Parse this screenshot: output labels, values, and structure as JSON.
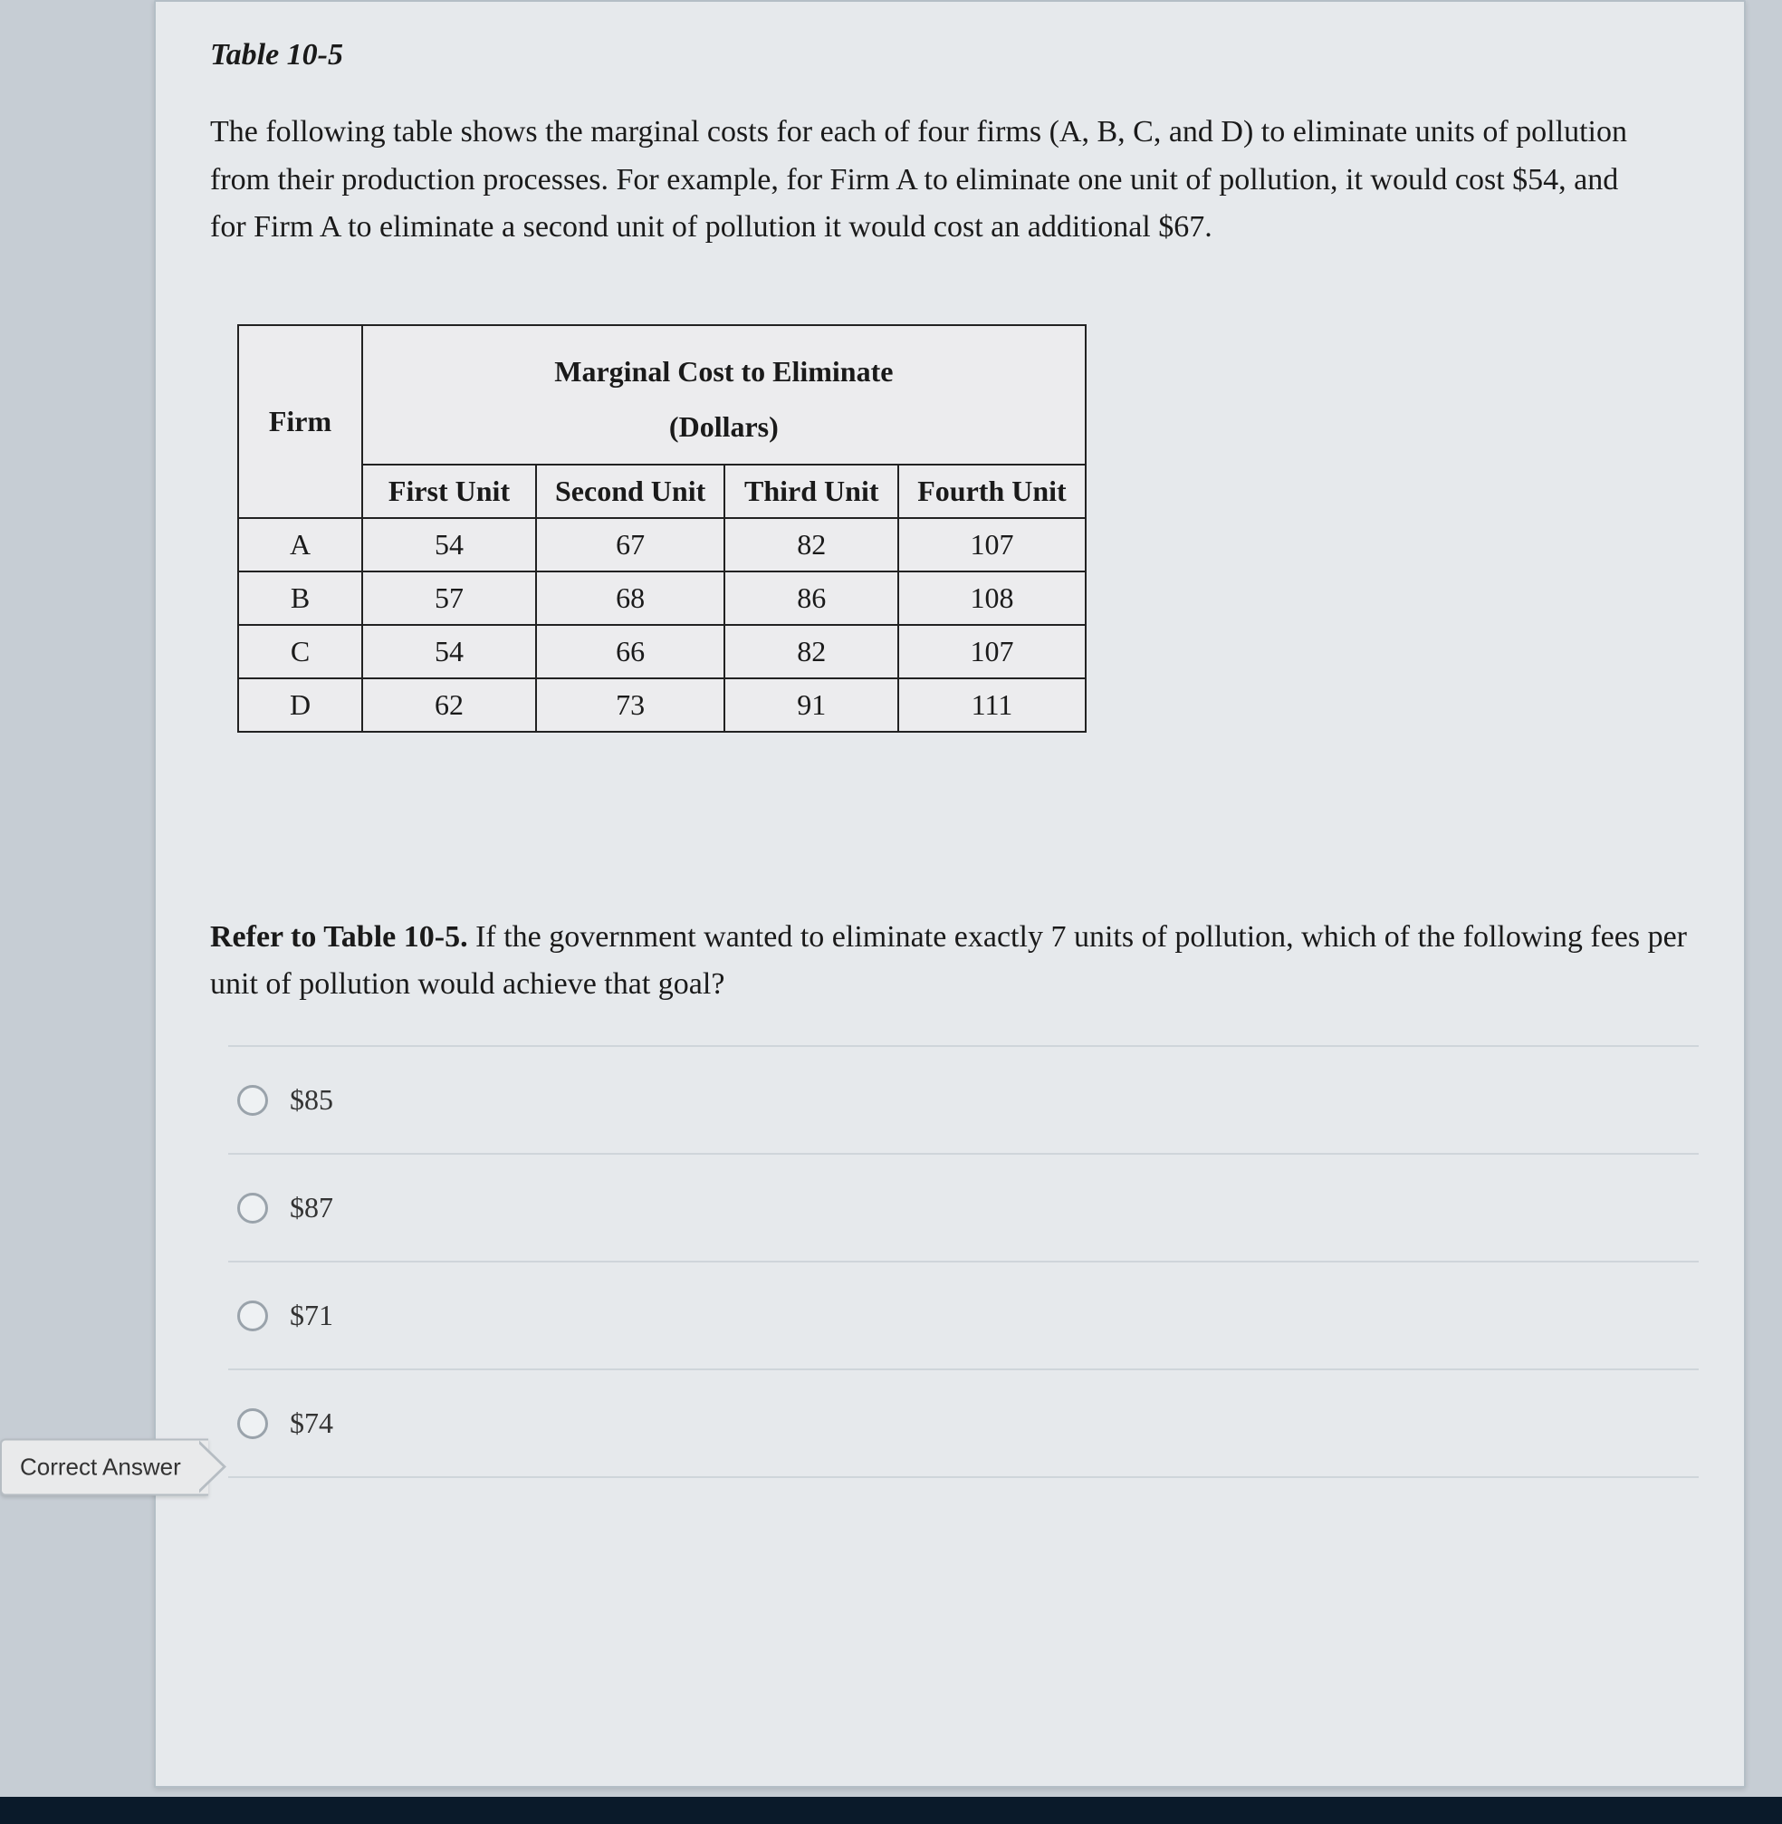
{
  "tableTitle": "Table 10-5",
  "intro": "The following table shows the marginal costs for each of four firms (A, B, C, and D) to eliminate units of pollution from their production processes. For example, for Firm A to eliminate one unit of pollution, it would cost $54, and for Firm A to eliminate a second unit of pollution it would cost an additional $67.",
  "table": {
    "firmHeader": "Firm",
    "mcHeaderLine1": "Marginal Cost to Eliminate",
    "mcHeaderLine2": "(Dollars)",
    "cols": [
      "First Unit",
      "Second Unit",
      "Third Unit",
      "Fourth Unit"
    ],
    "rows": [
      {
        "firm": "A",
        "v": [
          "54",
          "67",
          "82",
          "107"
        ]
      },
      {
        "firm": "B",
        "v": [
          "57",
          "68",
          "86",
          "108"
        ]
      },
      {
        "firm": "C",
        "v": [
          "54",
          "66",
          "82",
          "107"
        ]
      },
      {
        "firm": "D",
        "v": [
          "62",
          "73",
          "91",
          "111"
        ]
      }
    ]
  },
  "questionBoldRef": "Refer to Table 10-5.",
  "questionRest": " If the government wanted to eliminate exactly 7 units of pollution, which of the following fees per unit of pollution would achieve that goal?",
  "options": [
    {
      "label": "$85"
    },
    {
      "label": "$87"
    },
    {
      "label": "$71"
    },
    {
      "label": "$74"
    }
  ],
  "correctTag": "Correct Answer",
  "chart_data": {
    "type": "table",
    "title": "Marginal Cost to Eliminate (Dollars)",
    "columns": [
      "Firm",
      "First Unit",
      "Second Unit",
      "Third Unit",
      "Fourth Unit"
    ],
    "rows": [
      [
        "A",
        54,
        67,
        82,
        107
      ],
      [
        "B",
        57,
        68,
        86,
        108
      ],
      [
        "C",
        54,
        66,
        82,
        107
      ],
      [
        "D",
        62,
        73,
        91,
        111
      ]
    ]
  }
}
